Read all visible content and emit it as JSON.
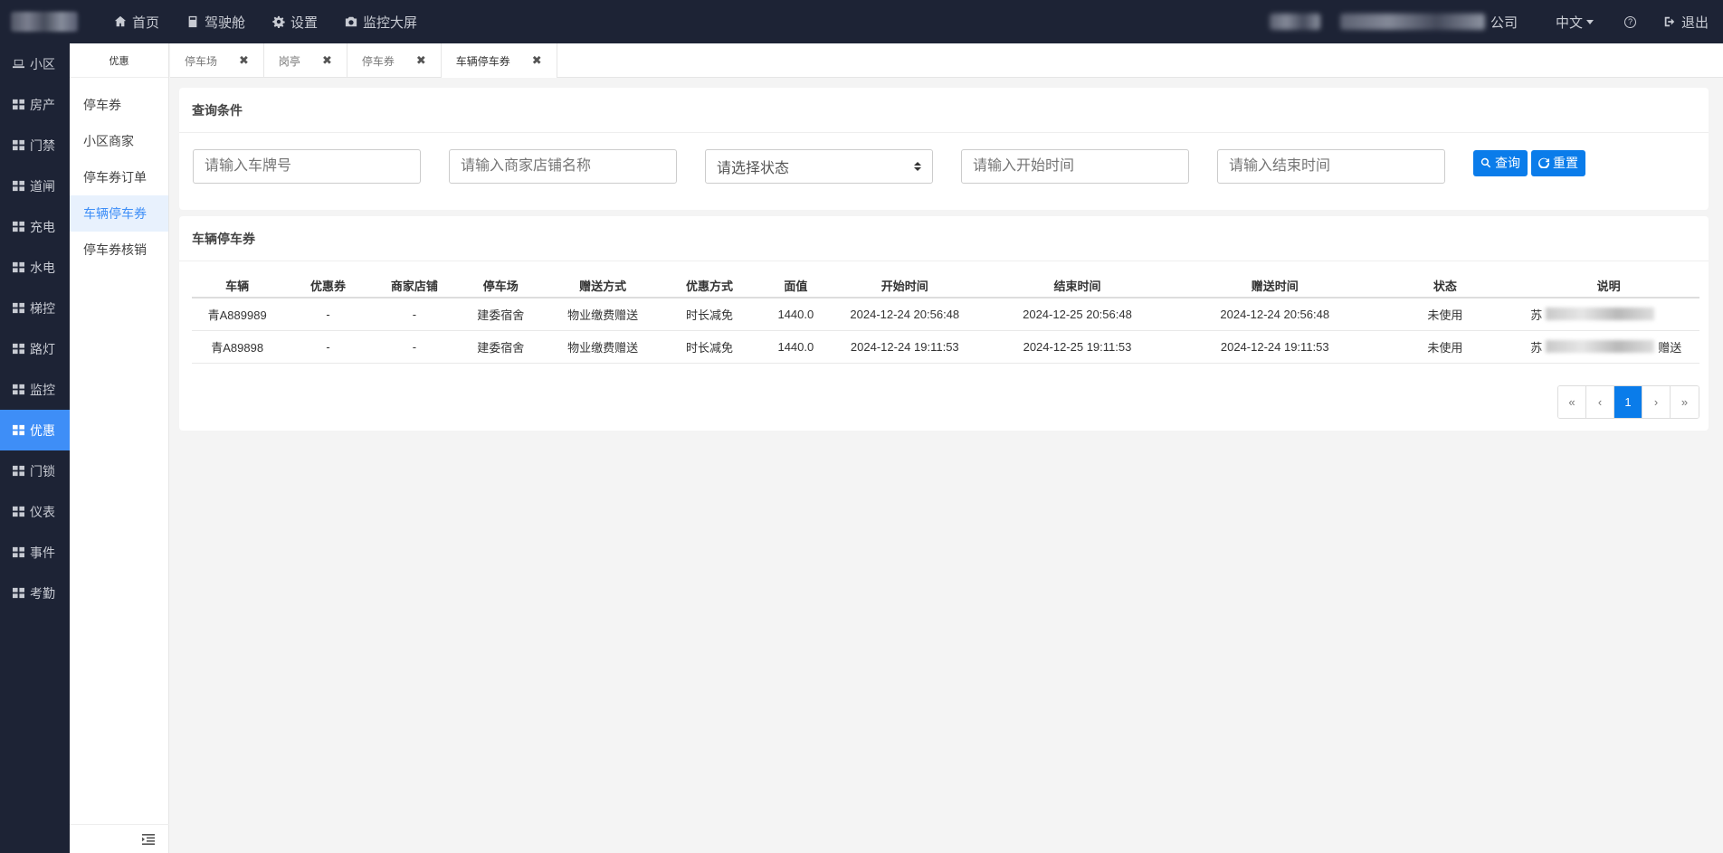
{
  "topnav": [
    {
      "label": "首页",
      "icon": "home-icon"
    },
    {
      "label": "驾驶舱",
      "icon": "calculator-icon"
    },
    {
      "label": "设置",
      "icon": "gear-icon"
    },
    {
      "label": "监控大屏",
      "icon": "camera-icon"
    }
  ],
  "header": {
    "company_suffix": "公司",
    "language": "中文",
    "help": "?",
    "logout": "退出"
  },
  "sidebar": [
    {
      "label": "小区",
      "icon": "laptop-icon"
    },
    {
      "label": "房产",
      "icon": "grid-icon"
    },
    {
      "label": "门禁",
      "icon": "grid-icon"
    },
    {
      "label": "道闸",
      "icon": "grid-icon"
    },
    {
      "label": "充电",
      "icon": "grid-icon"
    },
    {
      "label": "水电",
      "icon": "grid-icon"
    },
    {
      "label": "梯控",
      "icon": "grid-icon"
    },
    {
      "label": "路灯",
      "icon": "grid-icon"
    },
    {
      "label": "监控",
      "icon": "grid-icon"
    },
    {
      "label": "优惠",
      "icon": "grid-icon",
      "active": true
    },
    {
      "label": "门锁",
      "icon": "grid-icon"
    },
    {
      "label": "仪表",
      "icon": "grid-icon"
    },
    {
      "label": "事件",
      "icon": "grid-icon"
    },
    {
      "label": "考勤",
      "icon": "grid-icon"
    }
  ],
  "subside": {
    "title": "优惠",
    "items": [
      {
        "label": "停车券"
      },
      {
        "label": "小区商家"
      },
      {
        "label": "停车券订单"
      },
      {
        "label": "车辆停车券",
        "active": true
      },
      {
        "label": "停车券核销"
      }
    ]
  },
  "tabs": [
    {
      "label": "停车场"
    },
    {
      "label": "岗亭"
    },
    {
      "label": "停车券"
    },
    {
      "label": "车辆停车券",
      "active": true
    }
  ],
  "query": {
    "title": "查询条件",
    "plate_placeholder": "请输入车牌号",
    "shop_placeholder": "请输入商家店铺名称",
    "status_value": "请选择状态",
    "start_placeholder": "请输入开始时间",
    "end_placeholder": "请输入结束时间",
    "search_label": "查询",
    "reset_label": "重置"
  },
  "table": {
    "title": "车辆停车券",
    "columns": [
      "车辆",
      "优惠券",
      "商家店铺",
      "停车场",
      "赠送方式",
      "优惠方式",
      "面值",
      "开始时间",
      "结束时间",
      "赠送时间",
      "状态",
      "说明"
    ],
    "rows": [
      [
        "青A889989",
        "-",
        "-",
        "建委宿舍",
        "物业缴费赠送",
        "时长减免",
        "1440.0",
        "2024-12-24 20:56:48",
        "2024-12-25 20:56:48",
        "2024-12-24 20:56:48",
        "未使用",
        "苏"
      ],
      [
        "青A89898",
        "-",
        "-",
        "建委宿舍",
        "物业缴费赠送",
        "时长减免",
        "1440.0",
        "2024-12-24 19:11:53",
        "2024-12-25 19:11:53",
        "2024-12-24 19:11:53",
        "未使用",
        "苏"
      ]
    ],
    "desc_tail": [
      "",
      "赠送"
    ]
  },
  "pagination": {
    "first": "«",
    "prev": "‹",
    "current": "1",
    "next": "›",
    "last": "»"
  },
  "colors": {
    "accent": "#3e8ef7",
    "button": "#0a7cea",
    "sidebar_bg": "#1d2335"
  }
}
